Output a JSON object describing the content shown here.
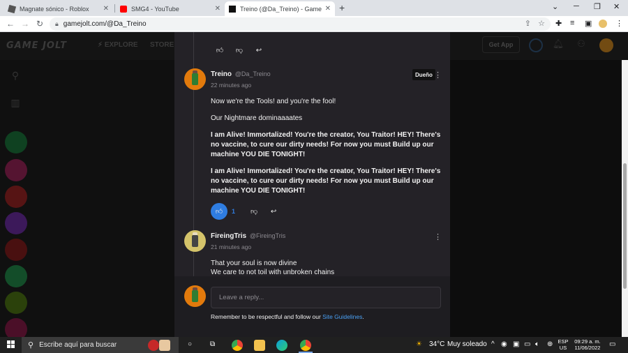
{
  "browser": {
    "tabs": [
      {
        "title": "Magnate sónico - Roblox",
        "active": false
      },
      {
        "title": "SMG4 - YouTube",
        "active": false
      },
      {
        "title": "Treino (@Da_Treino) - Game Jolt",
        "active": true
      }
    ],
    "new_tab": "+",
    "url": "gamejolt.com/@Da_Treino"
  },
  "site": {
    "logo": "GAME JOLT",
    "nav": {
      "explore": "EXPLORE",
      "store": "STORE"
    },
    "get_app": "Get App"
  },
  "comments": [
    {
      "author": "Treino",
      "handle": "@Da_Treino",
      "time": "22 minutes ago",
      "badge": "Dueño",
      "paragraphs": [
        "Now we're the Tools! and you're the fool!",
        "Our Nightmare dominaaaates"
      ],
      "bold_paragraphs": [
        "I am Alive! Immortalized! You're the creator, You Traitor! HEY! There's no vaccine, to cure our dirty needs! For now you must Build up our machine YOU DIE TONIGHT!",
        "I am Alive! Immortalized! You're the creator, You Traitor! HEY! There's no vaccine, to cure our dirty needs! For now you must Build up our machine YOU DIE TONIGHT!"
      ],
      "likes": "1",
      "liked": true
    },
    {
      "author": "FireingTris",
      "handle": "@FireingTris",
      "time": "21 minutes ago",
      "lines": [
        "That your soul is now divine",
        "We care to not toil with unbroken chains"
      ]
    }
  ],
  "composer": {
    "placeholder": "Leave a reply...",
    "guideline_prefix": "Remember to be respectful and follow our ",
    "guideline_link": "Site Guidelines",
    "guideline_suffix": "."
  },
  "taskbar": {
    "search_placeholder": "Escribe aquí para buscar",
    "weather_temp": "34°C",
    "weather_desc": "Muy soleado",
    "lang": "ESP",
    "region": "US",
    "time": "09:29 a. m.",
    "date": "11/06/2022"
  },
  "colors": {
    "accent_blue": "#2f7de1",
    "link_blue": "#4aa0f3",
    "modal_bg": "#242227",
    "avatar_orange": "#e27a0c"
  }
}
